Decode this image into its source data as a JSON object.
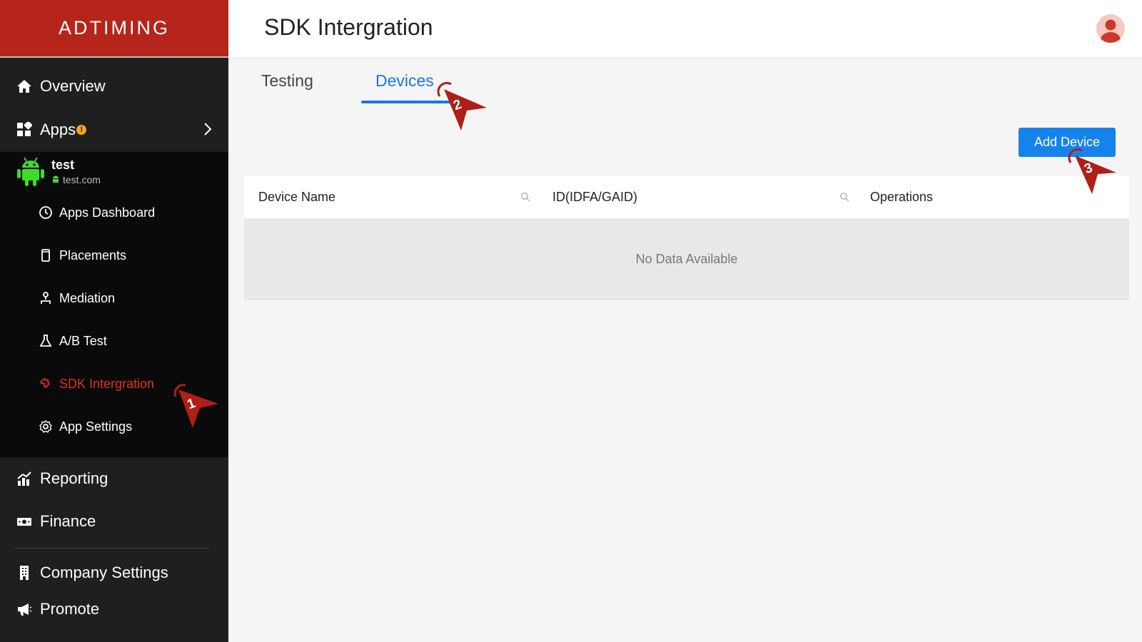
{
  "brand": {
    "logo_text": "ADTIMING",
    "color": "#b5251b"
  },
  "nav": {
    "overview": "Overview",
    "apps": "Apps",
    "apps_badge": "!",
    "app": {
      "name": "test",
      "domain": "test.com"
    },
    "sub_items": [
      {
        "label": "Apps Dashboard",
        "icon": "clock-icon"
      },
      {
        "label": "Placements",
        "icon": "phone-icon"
      },
      {
        "label": "Mediation",
        "icon": "mediation-icon"
      },
      {
        "label": "A/B Test",
        "icon": "flask-icon"
      },
      {
        "label": "SDK Intergration",
        "icon": "puzzle-icon",
        "active": true
      },
      {
        "label": "App Settings",
        "icon": "gear-icon"
      }
    ],
    "reporting": "Reporting",
    "finance": "Finance",
    "company_settings": "Company Settings",
    "promote": "Promote"
  },
  "header": {
    "title": "SDK Intergration"
  },
  "tabs": [
    {
      "label": "Testing",
      "active": false
    },
    {
      "label": "Devices",
      "active": true
    }
  ],
  "actions": {
    "add_device": "Add Device"
  },
  "table": {
    "columns": [
      "Device Name",
      "ID(IDFA/GAID)",
      "Operations"
    ],
    "empty_text": "No Data Available"
  },
  "markers": [
    "1",
    "2",
    "3"
  ],
  "colors": {
    "accent": "#1677e6",
    "active_nav": "#e0321e",
    "marker": "#b01e17"
  }
}
